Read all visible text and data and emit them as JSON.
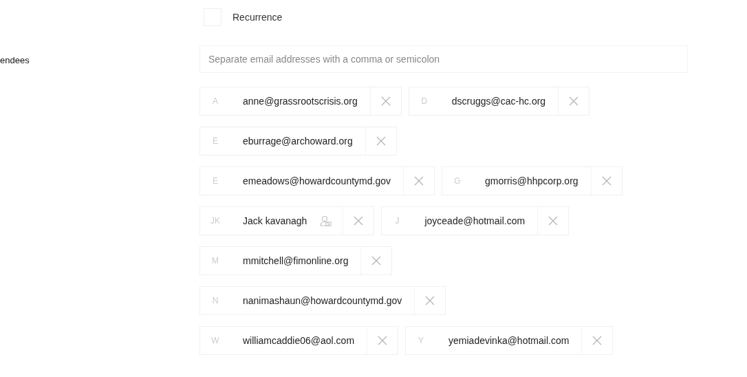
{
  "recurrence": {
    "label": "Recurrence",
    "checked": false
  },
  "attendees": {
    "label": "endees",
    "placeholder": "Separate email addresses with a comma or semicolon",
    "rows": [
      {
        "chips": [
          {
            "initial": "A",
            "email": "anne@grassrootscrisis.org"
          },
          {
            "initial": "D",
            "email": "dscruggs@cac-hc.org"
          }
        ]
      },
      {
        "chips": [
          {
            "initial": "E",
            "email": "eburrage@archoward.org"
          }
        ]
      },
      {
        "chips": [
          {
            "initial": "E",
            "email": "emeadows@howardcountymd.gov"
          },
          {
            "initial": "G",
            "email": "gmorris@hhpcorp.org"
          }
        ]
      },
      {
        "chips": [
          {
            "initial": "JK",
            "email": "Jack kavanagh",
            "kind": "group"
          },
          {
            "initial": "J",
            "email": "joyceade@hotmail.com"
          }
        ]
      },
      {
        "chips": [
          {
            "initial": "M",
            "email": "mmitchell@fimonline.org"
          }
        ]
      },
      {
        "chips": [
          {
            "initial": "N",
            "email": "nanimashaun@howardcountymd.gov"
          }
        ]
      },
      {
        "chips": [
          {
            "initial": "W",
            "email": "williamcaddie06@aol.com"
          },
          {
            "initial": "Y",
            "email": "yemiadevinka@hotmail.com"
          }
        ]
      }
    ]
  }
}
